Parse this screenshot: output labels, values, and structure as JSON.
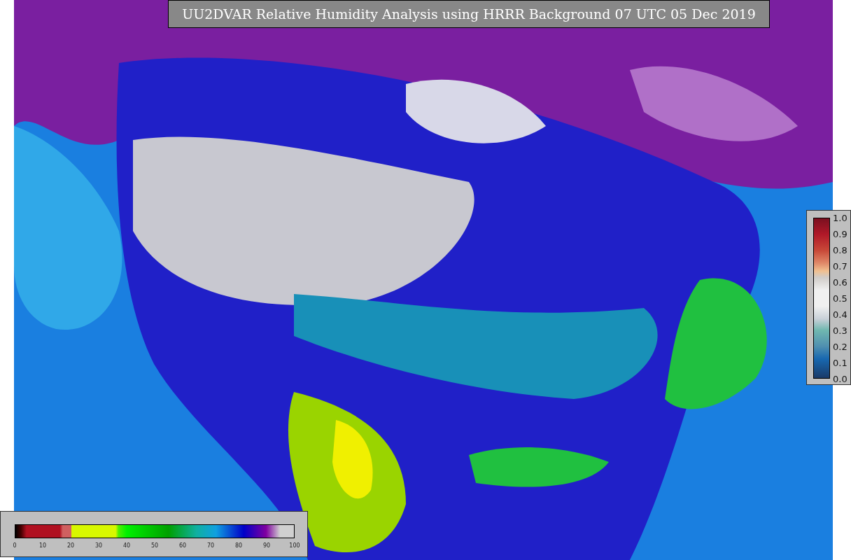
{
  "title": "UU2DVAR Relative Humidity Analysis using HRRR Background 07 UTC 05 Dec 2019",
  "humidity_legend": {
    "ticks": [
      "0",
      "10",
      "20",
      "30",
      "40",
      "50",
      "60",
      "70",
      "80",
      "90",
      "100"
    ]
  },
  "ratio_legend": {
    "ticks": [
      "1.0",
      "0.9",
      "0.8",
      "0.7",
      "0.6",
      "0.5",
      "0.4",
      "0.3",
      "0.2",
      "0.1",
      "0.0"
    ]
  }
}
